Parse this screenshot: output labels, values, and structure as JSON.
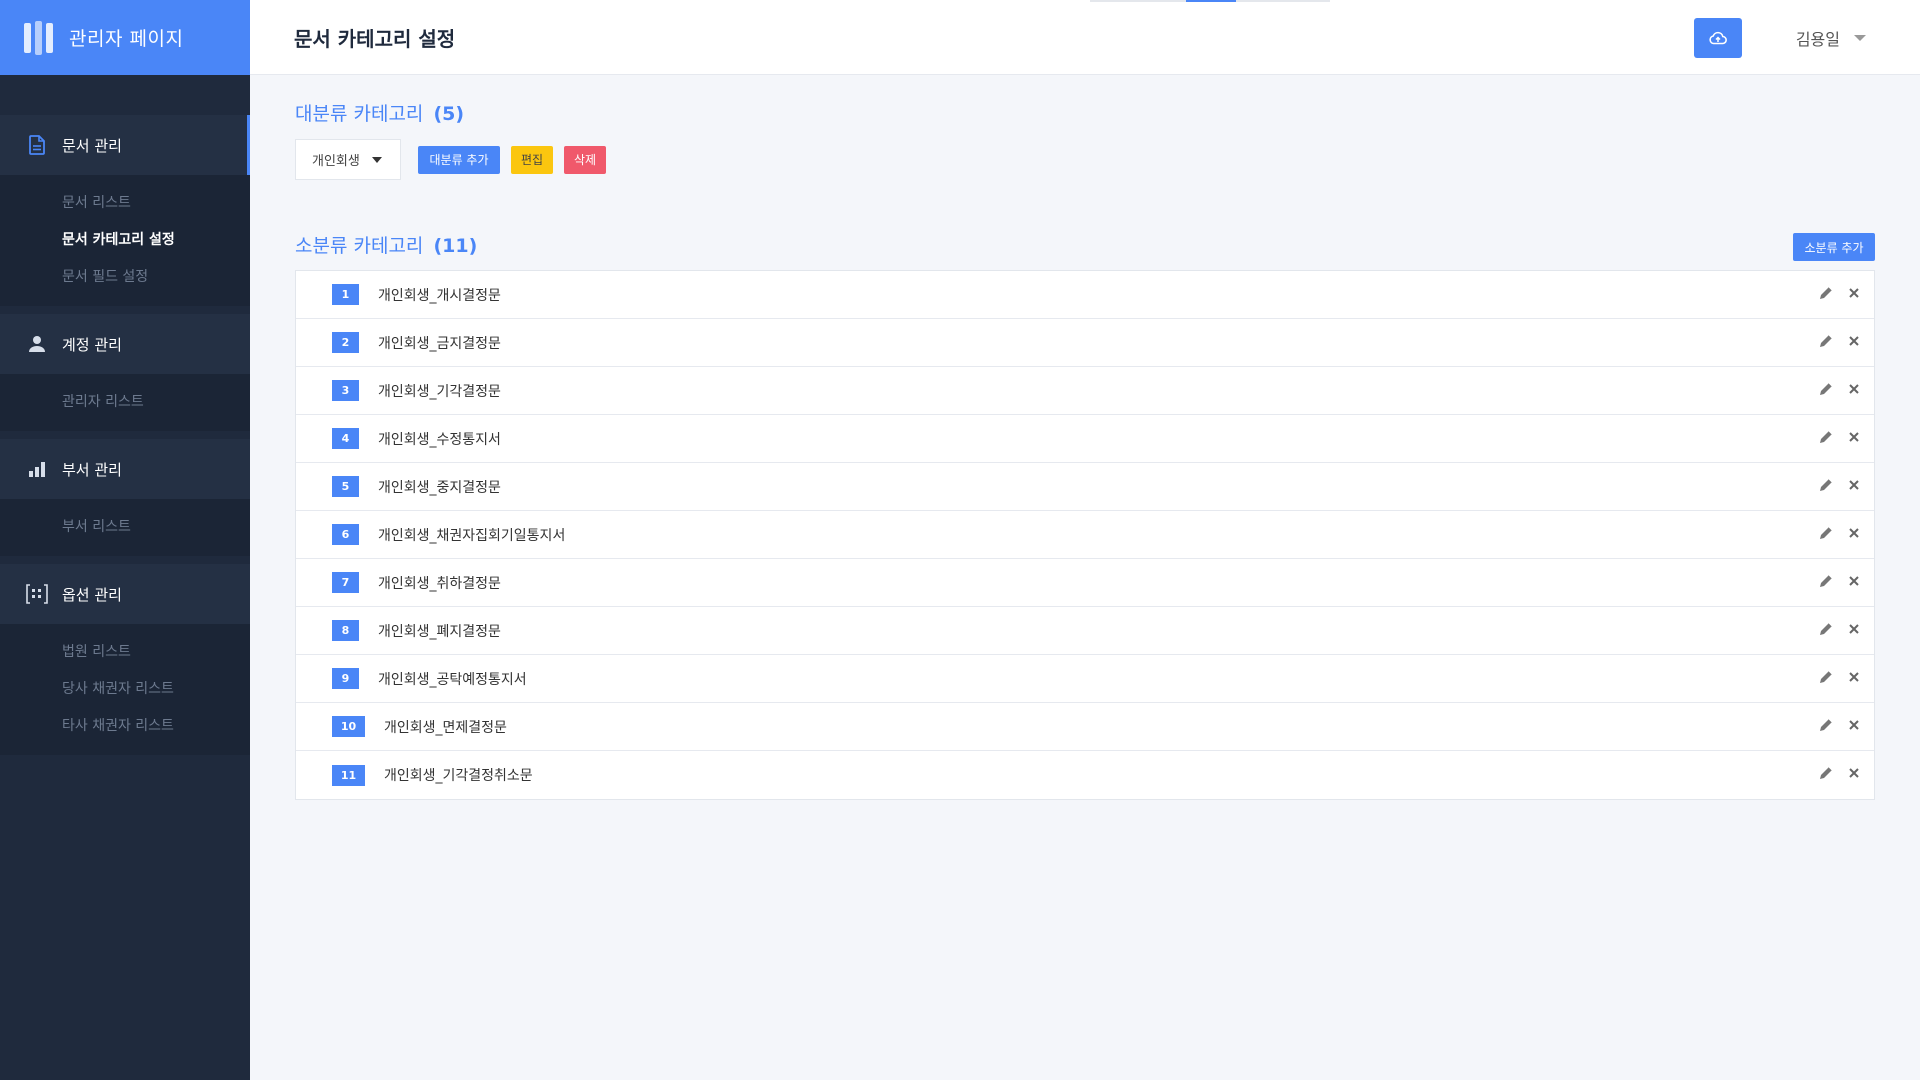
{
  "brand": {
    "title": "관리자 페이지"
  },
  "header": {
    "title": "문서 카테고리 설정",
    "user_name": "김용일"
  },
  "sidebar": {
    "groups": [
      {
        "label": "문서 관리",
        "icon": "document-icon",
        "items": [
          {
            "label": "문서 리스트"
          },
          {
            "label": "문서 카테고리 설정"
          },
          {
            "label": "문서 필드 설정"
          }
        ]
      },
      {
        "label": "계정 관리",
        "icon": "person-icon",
        "items": [
          {
            "label": "관리자 리스트"
          }
        ]
      },
      {
        "label": "부서 관리",
        "icon": "bar-chart-icon",
        "items": [
          {
            "label": "부서 리스트"
          }
        ]
      },
      {
        "label": "옵션 관리",
        "icon": "bracket-options-icon",
        "items": [
          {
            "label": "법원 리스트"
          },
          {
            "label": "당사 채권자 리스트"
          },
          {
            "label": "타사 채권자 리스트"
          }
        ]
      }
    ]
  },
  "major": {
    "title": "대분류 카테고리",
    "count": "(5)",
    "selected": "개인회생",
    "add_label": "대분류 추가",
    "edit_label": "편집",
    "delete_label": "삭제"
  },
  "minor": {
    "title": "소분류 카테고리",
    "count": "(11)",
    "add_label": "소분류 추가",
    "rows": [
      {
        "num": "1",
        "label": "개인회생_개시결정문"
      },
      {
        "num": "2",
        "label": "개인회생_금지결정문"
      },
      {
        "num": "3",
        "label": "개인회생_기각결정문"
      },
      {
        "num": "4",
        "label": "개인회생_수정통지서"
      },
      {
        "num": "5",
        "label": "개인회생_중지결정문"
      },
      {
        "num": "6",
        "label": "개인회생_채권자집회기일통지서"
      },
      {
        "num": "7",
        "label": "개인회생_취하결정문"
      },
      {
        "num": "8",
        "label": "개인회생_폐지결정문"
      },
      {
        "num": "9",
        "label": "개인회생_공탁예정통지서"
      },
      {
        "num": "10",
        "label": "개인회생_면제결정문"
      },
      {
        "num": "11",
        "label": "개인회생_기각결정취소문"
      }
    ]
  },
  "colors": {
    "accent": "#4a86f7",
    "sidebar": "#1f2a3d",
    "warning": "#fbc60f",
    "danger": "#f0596b"
  }
}
